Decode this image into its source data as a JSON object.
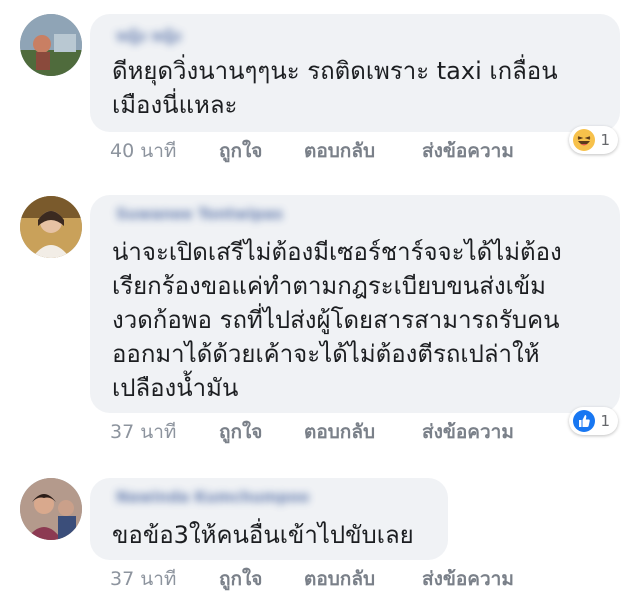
{
  "comments": [
    {
      "author": "หญิง หญิง",
      "text": "ดีหยุดวิ่งนานๆๆนะ รถติดเพราะ taxi เกลื่อน\nเมืองนี่แหละ",
      "time": "40 นาที",
      "like_label": "ถูกใจ",
      "reply_label": "ตอบกลับ",
      "message_label": "ส่งข้อความ",
      "reaction_icon": "haha-icon",
      "reaction_count": "1"
    },
    {
      "author": "Suwanee Tontwipas",
      "text": "น่าจะเปิดเสรีไม่ต้องมีเซอร์ชาร์จจะได้ไม่ต้อง\nเรียกร้องขอแค่ทำตามกฎระเบียบขนส่งเข้ม\nงวดก้อพอ รถที่ไปส่งผู้โดยสารสามารถรับคน\nออกมาได้ด้วยเค้าจะได้ไม่ต้องตีรถเปล่าให้\nเปลืองน้ำมัน",
      "time": "37 นาที",
      "like_label": "ถูกใจ",
      "reply_label": "ตอบกลับ",
      "message_label": "ส่งข้อความ",
      "reaction_icon": "like-icon",
      "reaction_count": "1"
    },
    {
      "author": "Nawinda Kumchumpoo",
      "text": "ขอข้อ3ให้คนอื่นเข้าไปขับเลย",
      "time": "37 นาที",
      "like_label": "ถูกใจ",
      "reply_label": "ตอบกลับ",
      "message_label": "ส่งข้อความ"
    }
  ]
}
